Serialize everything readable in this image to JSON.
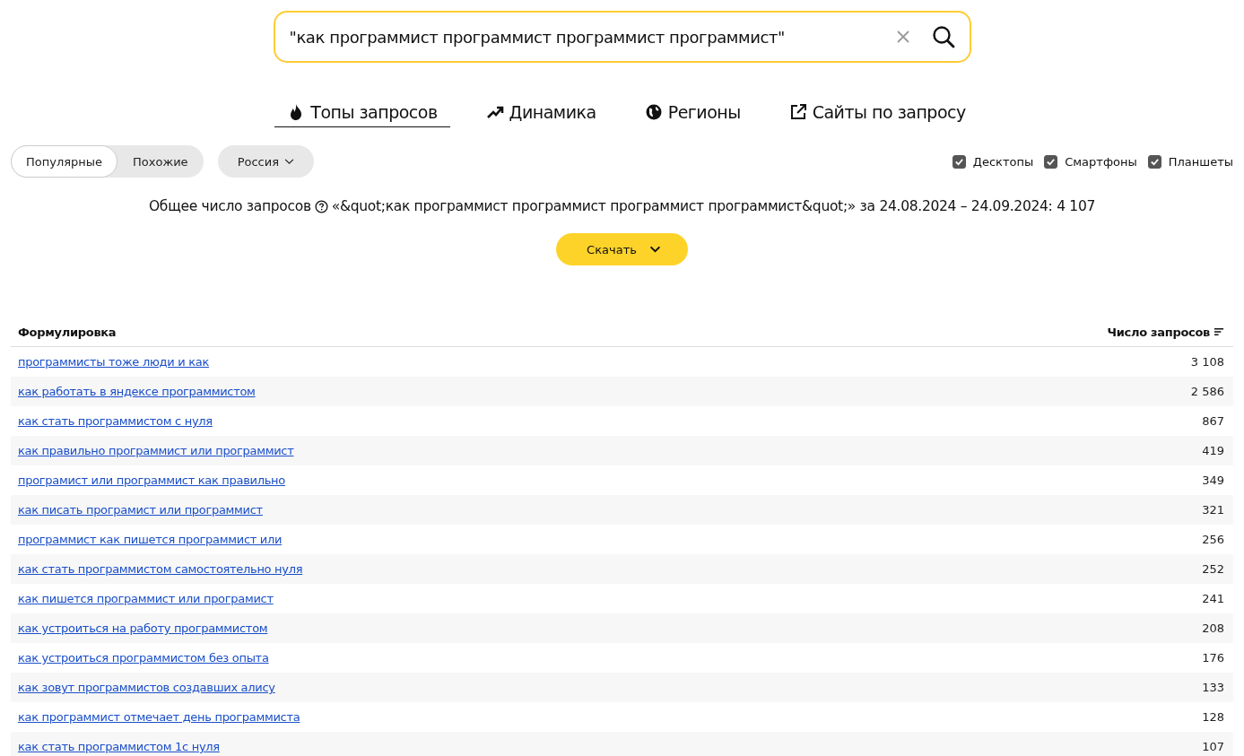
{
  "search": {
    "value": "\"как программист программист программист программист\""
  },
  "tabs": [
    {
      "label": "Топы запросов",
      "kind": "fire",
      "selected": true
    },
    {
      "label": "Динамика",
      "kind": "trend",
      "selected": false
    },
    {
      "label": "Регионы",
      "kind": "globe",
      "selected": false
    },
    {
      "label": "Сайты по запросу",
      "kind": "external",
      "selected": false
    }
  ],
  "mode_switch": [
    {
      "label": "Популярные",
      "selected": true
    },
    {
      "label": "Похожие",
      "selected": false
    }
  ],
  "region": {
    "label": "Россия"
  },
  "devices": [
    {
      "label": "Десктопы",
      "checked": true
    },
    {
      "label": "Смартфоны",
      "checked": true
    },
    {
      "label": "Планшеты",
      "checked": true
    }
  ],
  "summary": {
    "label": "Общее число запросов",
    "text": "«&quot;как программист программист программист программист&quot;» за 24.08.2024 – 24.09.2024: 4 107"
  },
  "download_button": {
    "label": "Скачать"
  },
  "table": {
    "columns": [
      "Формулировка",
      "Число запросов"
    ],
    "rows": [
      {
        "query": "программисты тоже люди и как",
        "count": "3 108"
      },
      {
        "query": "как работать в яндексе программистом",
        "count": "2 586"
      },
      {
        "query": "как стать программистом с нуля",
        "count": "867"
      },
      {
        "query": "как правильно программист или программист",
        "count": "419"
      },
      {
        "query": "програмист или программист как правильно",
        "count": "349"
      },
      {
        "query": "как писать програмист или программист",
        "count": "321"
      },
      {
        "query": "программист как пишется программист или",
        "count": "256"
      },
      {
        "query": "как стать программистом самостоятельно нуля",
        "count": "252"
      },
      {
        "query": "как пишется программист или програмист",
        "count": "241"
      },
      {
        "query": "как устроиться на работу программистом",
        "count": "208"
      },
      {
        "query": "как устроиться программистом без опыта",
        "count": "176"
      },
      {
        "query": "как зовут программистов создавших алису",
        "count": "133"
      },
      {
        "query": "как программист отмечает день программиста",
        "count": "128"
      },
      {
        "query": "как стать программистом 1с нуля",
        "count": "107"
      }
    ]
  }
}
